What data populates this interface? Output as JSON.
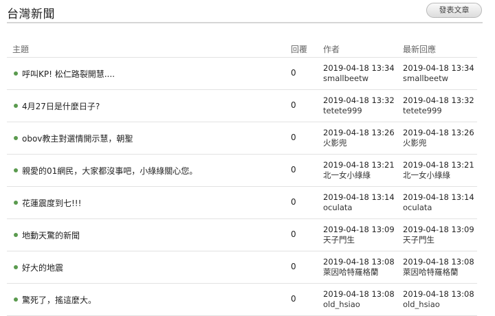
{
  "page": {
    "title": "台灣新聞",
    "post_button": "發表文章"
  },
  "columns": {
    "subject": "主題",
    "replies": "回覆",
    "author": "作者",
    "latest": "最新回應"
  },
  "accent_color": "#5a9a4e",
  "rows": [
    {
      "subject": "呼叫KP! 松仁路裂開慧....",
      "replies": "0",
      "author_time": "2019-04-18 13:34",
      "author": "smallbeetw",
      "latest_time": "2019-04-18 13:34",
      "latest_user": "smallbeetw"
    },
    {
      "subject": "4月27日是什麼日子?",
      "replies": "0",
      "author_time": "2019-04-18 13:32",
      "author": "tetete999",
      "latest_time": "2019-04-18 13:32",
      "latest_user": "tetete999"
    },
    {
      "subject": "obov教主對選情開示慧，朝聖",
      "replies": "0",
      "author_time": "2019-04-18 13:26",
      "author": "火影兜",
      "latest_time": "2019-04-18 13:26",
      "latest_user": "火影兜"
    },
    {
      "subject": "親愛的01網民，大家都沒事吧，小綠綠關心您。",
      "replies": "0",
      "author_time": "2019-04-18 13:21",
      "author": "北一女小綠綠",
      "latest_time": "2019-04-18 13:21",
      "latest_user": "北一女小綠綠"
    },
    {
      "subject": "花蓮震度到七!!!",
      "replies": "0",
      "author_time": "2019-04-18 13:14",
      "author": "oculata",
      "latest_time": "2019-04-18 13:14",
      "latest_user": "oculata"
    },
    {
      "subject": "地動天驚的新聞",
      "replies": "0",
      "author_time": "2019-04-18 13:09",
      "author": "天子門生",
      "latest_time": "2019-04-18 13:09",
      "latest_user": "天子門生"
    },
    {
      "subject": "好大的地震",
      "replies": "0",
      "author_time": "2019-04-18 13:08",
      "author": "萊因哈特羅格蘭",
      "latest_time": "2019-04-18 13:08",
      "latest_user": "萊因哈特羅格蘭"
    },
    {
      "subject": "驚死了，搖這麼大。",
      "replies": "0",
      "author_time": "2019-04-18 13:08",
      "author": "old_hsiao",
      "latest_time": "2019-04-18 13:08",
      "latest_user": "old_hsiao"
    }
  ]
}
